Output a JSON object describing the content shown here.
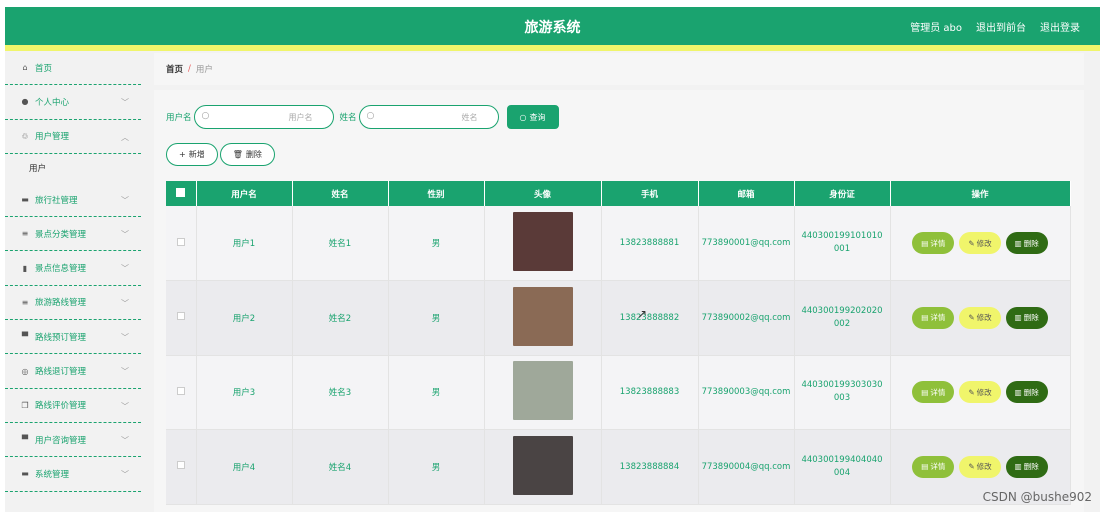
{
  "header": {
    "title": "旅游系统",
    "admin": "管理员 abo",
    "back_front": "退出到前台",
    "logout": "退出登录"
  },
  "sidebar": {
    "items": [
      {
        "label": "首页",
        "icon": "home-icon"
      },
      {
        "label": "个人中心",
        "icon": "user-icon"
      },
      {
        "label": "用户管理",
        "icon": "user-manage-icon"
      },
      {
        "label": "旅行社管理",
        "icon": "agency-icon"
      },
      {
        "label": "景点分类管理",
        "icon": "list-icon"
      },
      {
        "label": "景点信息管理",
        "icon": "chart-icon"
      },
      {
        "label": "旅游路线管理",
        "icon": "list-icon"
      },
      {
        "label": "路线预订管理",
        "icon": "monitor-icon"
      },
      {
        "label": "路线退订管理",
        "icon": "globe-icon"
      },
      {
        "label": "路线评价管理",
        "icon": "copy-icon"
      },
      {
        "label": "用户咨询管理",
        "icon": "monitor-icon"
      },
      {
        "label": "系统管理",
        "icon": "chat-icon"
      }
    ],
    "sub_user": "用户"
  },
  "breadcrumb": {
    "home": "首页",
    "sep": "/",
    "current": "用户"
  },
  "search": {
    "username_label": "用户名",
    "username_placeholder": "用户名",
    "name_label": "姓名",
    "name_placeholder": "姓名",
    "query_button": "查询"
  },
  "actions": {
    "add": "新增",
    "delete": "删除"
  },
  "table": {
    "columns": [
      "用户名",
      "姓名",
      "性别",
      "头像",
      "手机",
      "邮箱",
      "身份证",
      "操作"
    ],
    "rows": [
      {
        "username": "用户1",
        "name": "姓名1",
        "gender": "男",
        "phone": "13823888881",
        "email": "773890001@qq.com",
        "idcard": "440300199101010001",
        "avatar_color": "#5a3a38"
      },
      {
        "username": "用户2",
        "name": "姓名2",
        "gender": "男",
        "phone": "13823888882",
        "email": "773890002@qq.com",
        "idcard": "440300199202020002",
        "avatar_color": "#8a6a55"
      },
      {
        "username": "用户3",
        "name": "姓名3",
        "gender": "男",
        "phone": "13823888883",
        "email": "773890003@qq.com",
        "idcard": "440300199303030003",
        "avatar_color": "#9fa89a"
      },
      {
        "username": "用户4",
        "name": "姓名4",
        "gender": "男",
        "phone": "13823888884",
        "email": "773890004@qq.com",
        "idcard": "440300199404040004",
        "avatar_color": "#4a4444"
      }
    ],
    "op_detail": "详情",
    "op_edit": "修改",
    "op_delete": "删除"
  },
  "watermark": "CSDN @bushe902"
}
